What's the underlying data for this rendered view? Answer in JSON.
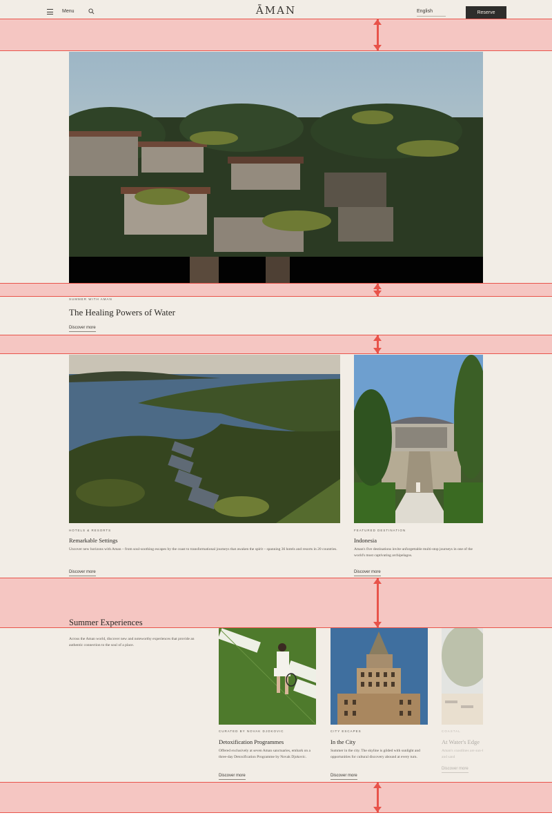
{
  "header": {
    "menu_label": "Menu",
    "logo": "ĀMAN",
    "language": "English",
    "reserve_label": "Reserve"
  },
  "hero": {
    "eyebrow": "SUMMER WITH AMAN",
    "title": "The Healing Powers of Water",
    "link": "Discover more"
  },
  "features": [
    {
      "eyebrow": "HOTELS & RESORTS",
      "title": "Remarkable Settings",
      "body": "Uncover new horizons with Aman – from soul-soothing escapes by the coast to transformational journeys that awaken the spirit – spanning 36 hotels and resorts in 20 countries.",
      "link": "Discover more"
    },
    {
      "eyebrow": "FEATURED DESTINATION",
      "title": "Indonesia",
      "body": "Aman's five destinations invite unforgettable multi-stop journeys in one of the world's most captivating archipelagos.",
      "link": "Discover more"
    }
  ],
  "experiences": {
    "title": "Summer Experiences",
    "intro": "Across the Aman world, discover new and noteworthy experiences that provide an authentic connection to the soul of a place.",
    "cards": [
      {
        "eyebrow": "CURATED BY NOVAK DJOKOVIC",
        "title": "Detoxification Programmes",
        "body": "Offered exclusively at seven Aman sanctuaries, embark on a three-day Detoxification Programme by Novak Djokovic.",
        "link": "Discover more"
      },
      {
        "eyebrow": "CITY ESCAPES",
        "title": "In the City",
        "body": "Summer in the city. The skyline is gilded with sunlight and opportunities for cultural discovery abound at every turn.",
        "link": "Discover more"
      },
      {
        "eyebrow": "COASTAL",
        "title": "At Water's Edge",
        "body": "Aman's coastlines are sun-kissed and sand",
        "link": "Discover more"
      }
    ]
  },
  "colors": {
    "background": "#f2ede6",
    "annotation_band": "#f5c6c2",
    "annotation_line": "#e8534a",
    "reserve_bg": "#2e2d2b"
  }
}
